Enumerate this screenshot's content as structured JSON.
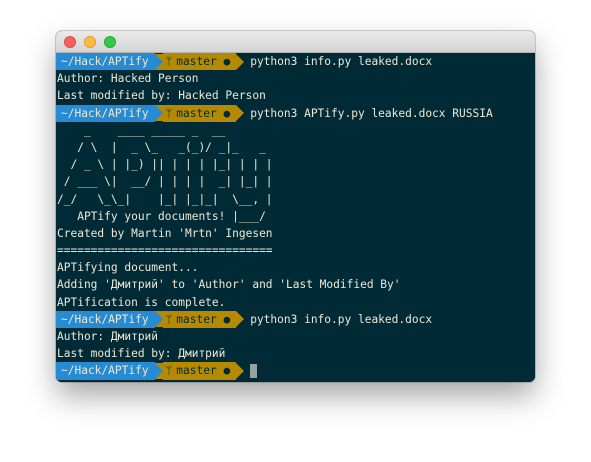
{
  "window": {
    "title": ""
  },
  "prompt": {
    "dir": "~/Hack/APTify",
    "branch_icon": "ᛘ",
    "branch": "master",
    "status": "●"
  },
  "lines": {
    "cmd1": "python3 info.py leaked.docx",
    "out1": "Author: Hacked Person",
    "out2": "Last modified by: Hacked Person",
    "cmd2": "python3 APTify.py leaked.docx RUSSIA",
    "art1": "    _    ____ _____ _  __",
    "art2": "   / \\  |  _ \\_   _(_)/ _|_   _",
    "art3": "  / _ \\ | |_) || | | | |_| | | |",
    "art4": " / ___ \\|  __/ | | | |  _| |_| |",
    "art5": "/_/   \\_\\_|    |_| |_|_|  \\__, |",
    "art6": "   APTify your documents! |___/",
    "credit": "Created by Martin 'Mrtn' Ingesen",
    "sep": "================================",
    "out3": "APTifying document...",
    "out4": "Adding 'Дмитрий' to 'Author' and 'Last Modified By'",
    "out5": "APTification is complete.",
    "cmd3": "python3 info.py leaked.docx",
    "out6": "Author: Дмитрий",
    "out7": "Last modified by: Дмитрий"
  },
  "colors": {
    "background": "#002b36",
    "dir_segment": "#268bd2",
    "git_segment": "#b58900",
    "text": "#eee8d5"
  }
}
